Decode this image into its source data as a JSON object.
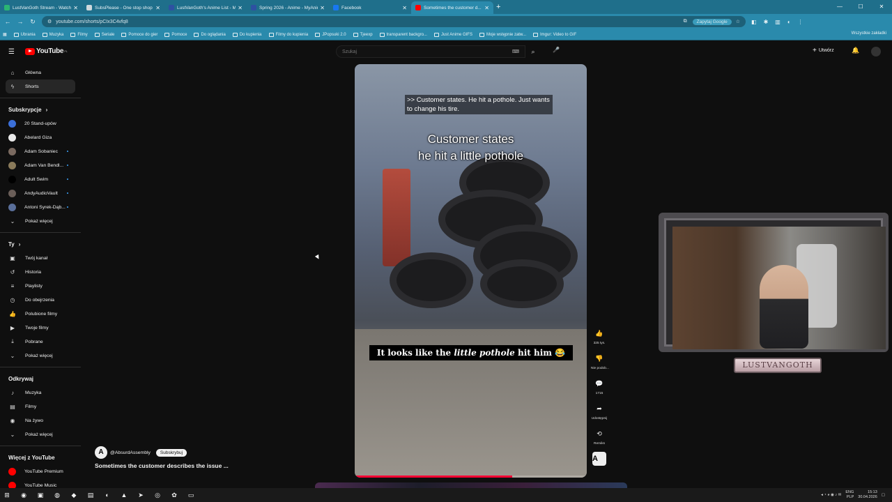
{
  "browser": {
    "tabs": [
      {
        "title": "LustVanGoth Stream - Watch Li...",
        "color": "#2bb673",
        "active": false
      },
      {
        "title": "SubsPlease - One stop shop fo...",
        "color": "#cfd8dc",
        "active": false
      },
      {
        "title": "LustVanGoth's Anime List - My...",
        "color": "#2e51a2",
        "active": false
      },
      {
        "title": "Spring 2026 - Anime - MyAnim...",
        "color": "#2e51a2",
        "active": false
      },
      {
        "title": "Facebook",
        "color": "#1877f2",
        "active": false
      },
      {
        "title": "Sometimes the customer d...",
        "color": "#ff0000",
        "active": true
      }
    ],
    "url": "youtube.com/shorts/pCIx3C4vfq8",
    "google_button": "Zapytaj Google",
    "bookmarks": [
      "Ubrania",
      "Muzyka",
      "Filmy",
      "Seriale",
      "Pomoce do gier",
      "Pomoce",
      "Do oglądania",
      "Do kupienia",
      "Filmy do kupienia",
      "JPopsuki 2.0",
      "Tjeexp",
      "transparent backgro...",
      "Just Anime GIFS",
      "Moje wstępnie zatw...",
      "Imgur: Video to GIF"
    ],
    "bookmarks_right": "Wszystkie zakładki"
  },
  "youtube": {
    "logo_text": "YouTube",
    "logo_region": "PL",
    "search_placeholder": "Szukaj",
    "create_label": "Utwórz",
    "sidebar": {
      "main": [
        {
          "label": "Główna",
          "icon": "⌂"
        },
        {
          "label": "Shorts",
          "icon": "ϟ",
          "active": true
        }
      ],
      "subs_header": "Subskrypcje",
      "subs": [
        {
          "label": "20 Stand-upów",
          "color": "#3b6fd8",
          "dot": false
        },
        {
          "label": "Abelard Giza",
          "color": "#e9e9e9",
          "dot": false
        },
        {
          "label": "Adam Sobaniec",
          "color": "#7a6a60",
          "dot": true
        },
        {
          "label": "Adam Van Bendl...",
          "color": "#8a7a5a",
          "dot": true
        },
        {
          "label": "Adult Swim",
          "color": "#000000",
          "dot": true
        },
        {
          "label": "AndyAudioVault",
          "color": "#6a5e58",
          "dot": true
        },
        {
          "label": "Antoni Syrek-Dąb...",
          "color": "#5a6f9a",
          "dot": true
        }
      ],
      "subs_more": "Pokaż więcej",
      "you_header": "Ty",
      "you": [
        {
          "label": "Twój kanał",
          "icon": "▣"
        },
        {
          "label": "Historia",
          "icon": "↺"
        },
        {
          "label": "Playlisty",
          "icon": "≡"
        },
        {
          "label": "Do obejrzenia",
          "icon": "◷"
        },
        {
          "label": "Polubione filmy",
          "icon": "👍"
        },
        {
          "label": "Twoje filmy",
          "icon": "▶"
        },
        {
          "label": "Pobrane",
          "icon": "⤓"
        }
      ],
      "you_more": "Pokaż więcej",
      "explore_header": "Odkrywaj",
      "explore": [
        {
          "label": "Muzyka",
          "icon": "♪"
        },
        {
          "label": "Filmy",
          "icon": "▤"
        },
        {
          "label": "Na żywo",
          "icon": "◉"
        }
      ],
      "explore_more": "Pokaż więcej",
      "more_header": "Więcej z YouTube",
      "more": [
        {
          "label": "YouTube Premium",
          "color": "#ff0000"
        },
        {
          "label": "YouTube Music",
          "color": "#ff0000"
        }
      ]
    },
    "short": {
      "caption_box": ">> Customer states. He hit a pothole. Just wants to change his tire.",
      "big_caption_line1": "Customer states",
      "big_caption_line2": "he hit a little pothole",
      "bottom_caption_pre": "It looks like the ",
      "bottom_caption_em": "little pothole",
      "bottom_caption_post": " hit him 😂",
      "progress": 0.68,
      "channel": "@AbsurdAssembly",
      "subscribe": "Subskrybuj",
      "title": "Sometimes the customer describes the issue ..."
    },
    "actions": [
      {
        "icon": "like-icon",
        "glyph": "👍",
        "label": "325 tys."
      },
      {
        "icon": "dislike-icon",
        "glyph": "👎",
        "label": "Nie podob..."
      },
      {
        "icon": "comment-icon",
        "glyph": "💬",
        "label": "1715"
      },
      {
        "icon": "share-icon",
        "glyph": "➦",
        "label": "Udostępnij"
      },
      {
        "icon": "remix-icon",
        "glyph": "⟲",
        "label": "Remiks"
      }
    ]
  },
  "webcam": {
    "nameplate": "LUSTVANGOTH"
  },
  "taskbar": {
    "lang": "ENG",
    "region": "PLP",
    "time": "15:13",
    "date": "30.04.2026"
  }
}
